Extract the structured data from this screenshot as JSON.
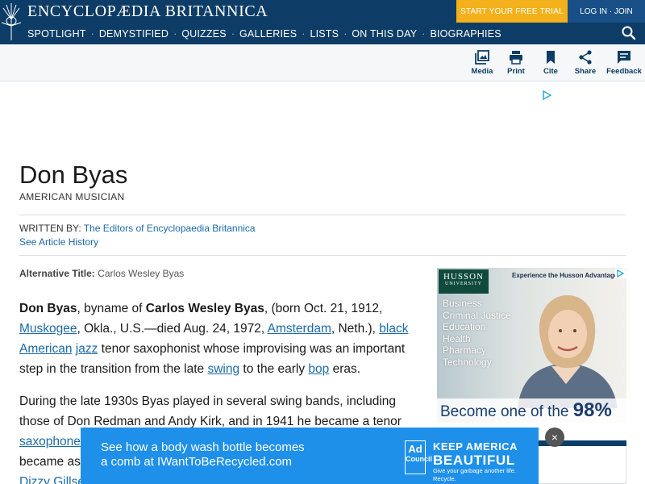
{
  "header": {
    "brand": "ENCYCLOPÆDIA BRITANNICA",
    "cta": "START YOUR FREE TRIAL",
    "login": "LOG IN · JOIN",
    "nav": [
      "SPOTLIGHT",
      "DEMYSTIFIED",
      "QUIZZES",
      "GALLERIES",
      "LISTS",
      "ON THIS DAY",
      "BIOGRAPHIES"
    ],
    "nav_separator": "·",
    "search_icon": "search-icon"
  },
  "tools": [
    {
      "label": "Media",
      "icon": "media-icon"
    },
    {
      "label": "Print",
      "icon": "print-icon"
    },
    {
      "label": "Cite",
      "icon": "bookmark-icon"
    },
    {
      "label": "Share",
      "icon": "share-icon"
    },
    {
      "label": "Feedback",
      "icon": "feedback-icon"
    }
  ],
  "article": {
    "title": "Don Byas",
    "subtitle": "AMERICAN MUSICIAN",
    "written_by_label": "WRITTEN BY:",
    "written_by_author": "The Editors of Encyclopaedia Britannica",
    "history_link": "See Article History",
    "alt_title_label": "Alternative Title:",
    "alt_title_value": "Carlos Wesley Byas",
    "p1": {
      "t1": "Don Byas",
      "t2": ", byname of ",
      "t3": "Carlos Wesley Byas",
      "t4": ", (born Oct. 21, 1912, ",
      "l1": "Muskogee",
      "t5": ", Okla., U.S.—died Aug. 24, 1972, ",
      "l2": "Amsterdam",
      "t6": ", Neth.), ",
      "l3": "black American",
      "t7": " ",
      "l4": "jazz",
      "t8": " tenor saxophonist whose improvising was an important step in the transition from the late ",
      "l5": "swing",
      "t9": " to the early ",
      "l6": "bop",
      "t10": " eras."
    },
    "p2": {
      "t1": "During the late 1930s Byas played in several swing bands, including those of Don Redman and Andy Kirk, and in 1941 he became a tenor ",
      "l1": "saxophone",
      "t2": " became as",
      "l2": "Dizzy Gillse"
    }
  },
  "side_ad": {
    "logo_line1": "HUSSON",
    "logo_line2": "UNIVERSITY",
    "tagline": "Experience the Husson Advantage!",
    "programs": [
      "Business",
      "Criminal Justice",
      "Education",
      "Health",
      "Pharmacy",
      "Technology"
    ],
    "banner_text": "Become one of the ",
    "banner_value": "98%"
  },
  "bottom_ad": {
    "line1": "See how a body wash bottle becomes",
    "line2": "a comb at IWantToBeRecycled.com",
    "logo_top": "Ad",
    "logo_bottom": "Council",
    "headline1": "KEEP AMERICA",
    "headline2": "BEAUTIFUL",
    "subline": "Give your garbage another life. Recycle.",
    "close_label": "×"
  }
}
